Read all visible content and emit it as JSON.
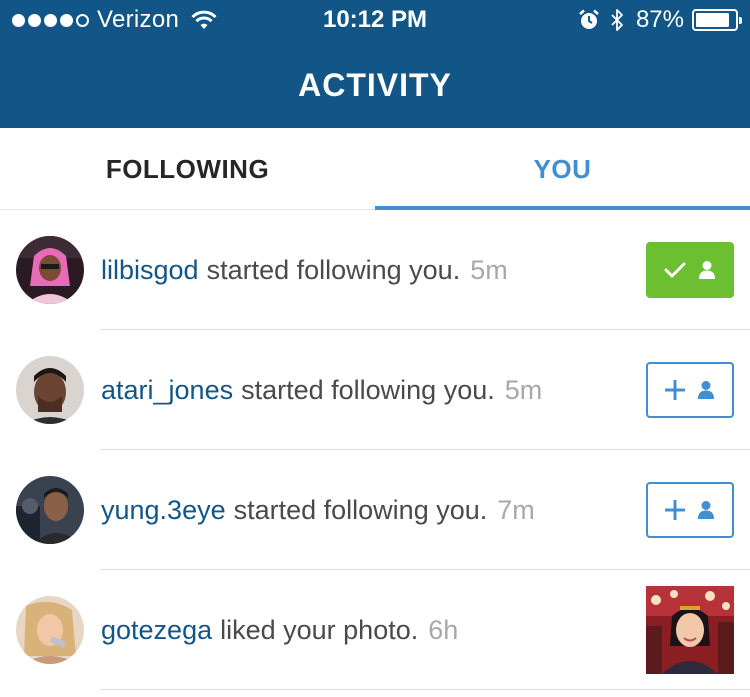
{
  "status_bar": {
    "carrier": "Verizon",
    "time": "10:12 PM",
    "battery": "87%",
    "battery_level": 0.87,
    "signal_bars_filled": 4,
    "signal_bars_total": 5
  },
  "header": {
    "title": "ACTIVITY"
  },
  "tabs": [
    {
      "label": "FOLLOWING",
      "active": false
    },
    {
      "label": "YOU",
      "active": true
    }
  ],
  "activity": [
    {
      "username": "lilbisgod",
      "action": "started following you.",
      "time": "5m",
      "button": "following-check",
      "button_icon": "checkmark-person-icon"
    },
    {
      "username": "atari_jones",
      "action": "started following you.",
      "time": "5m",
      "button": "follow",
      "button_icon": "plus-person-icon"
    },
    {
      "username": "yung.3eye",
      "action": "started following you.",
      "time": "7m",
      "button": "follow",
      "button_icon": "plus-person-icon"
    },
    {
      "username": "gotezega",
      "action": "liked your photo.",
      "time": "6h",
      "button": "photo-thumbnail"
    }
  ],
  "colors": {
    "header_bg": "#125688",
    "active_tab": "#3f8fd2",
    "username": "#125688",
    "following_green": "#6bbf31",
    "timestamp": "#a8a8a8"
  }
}
